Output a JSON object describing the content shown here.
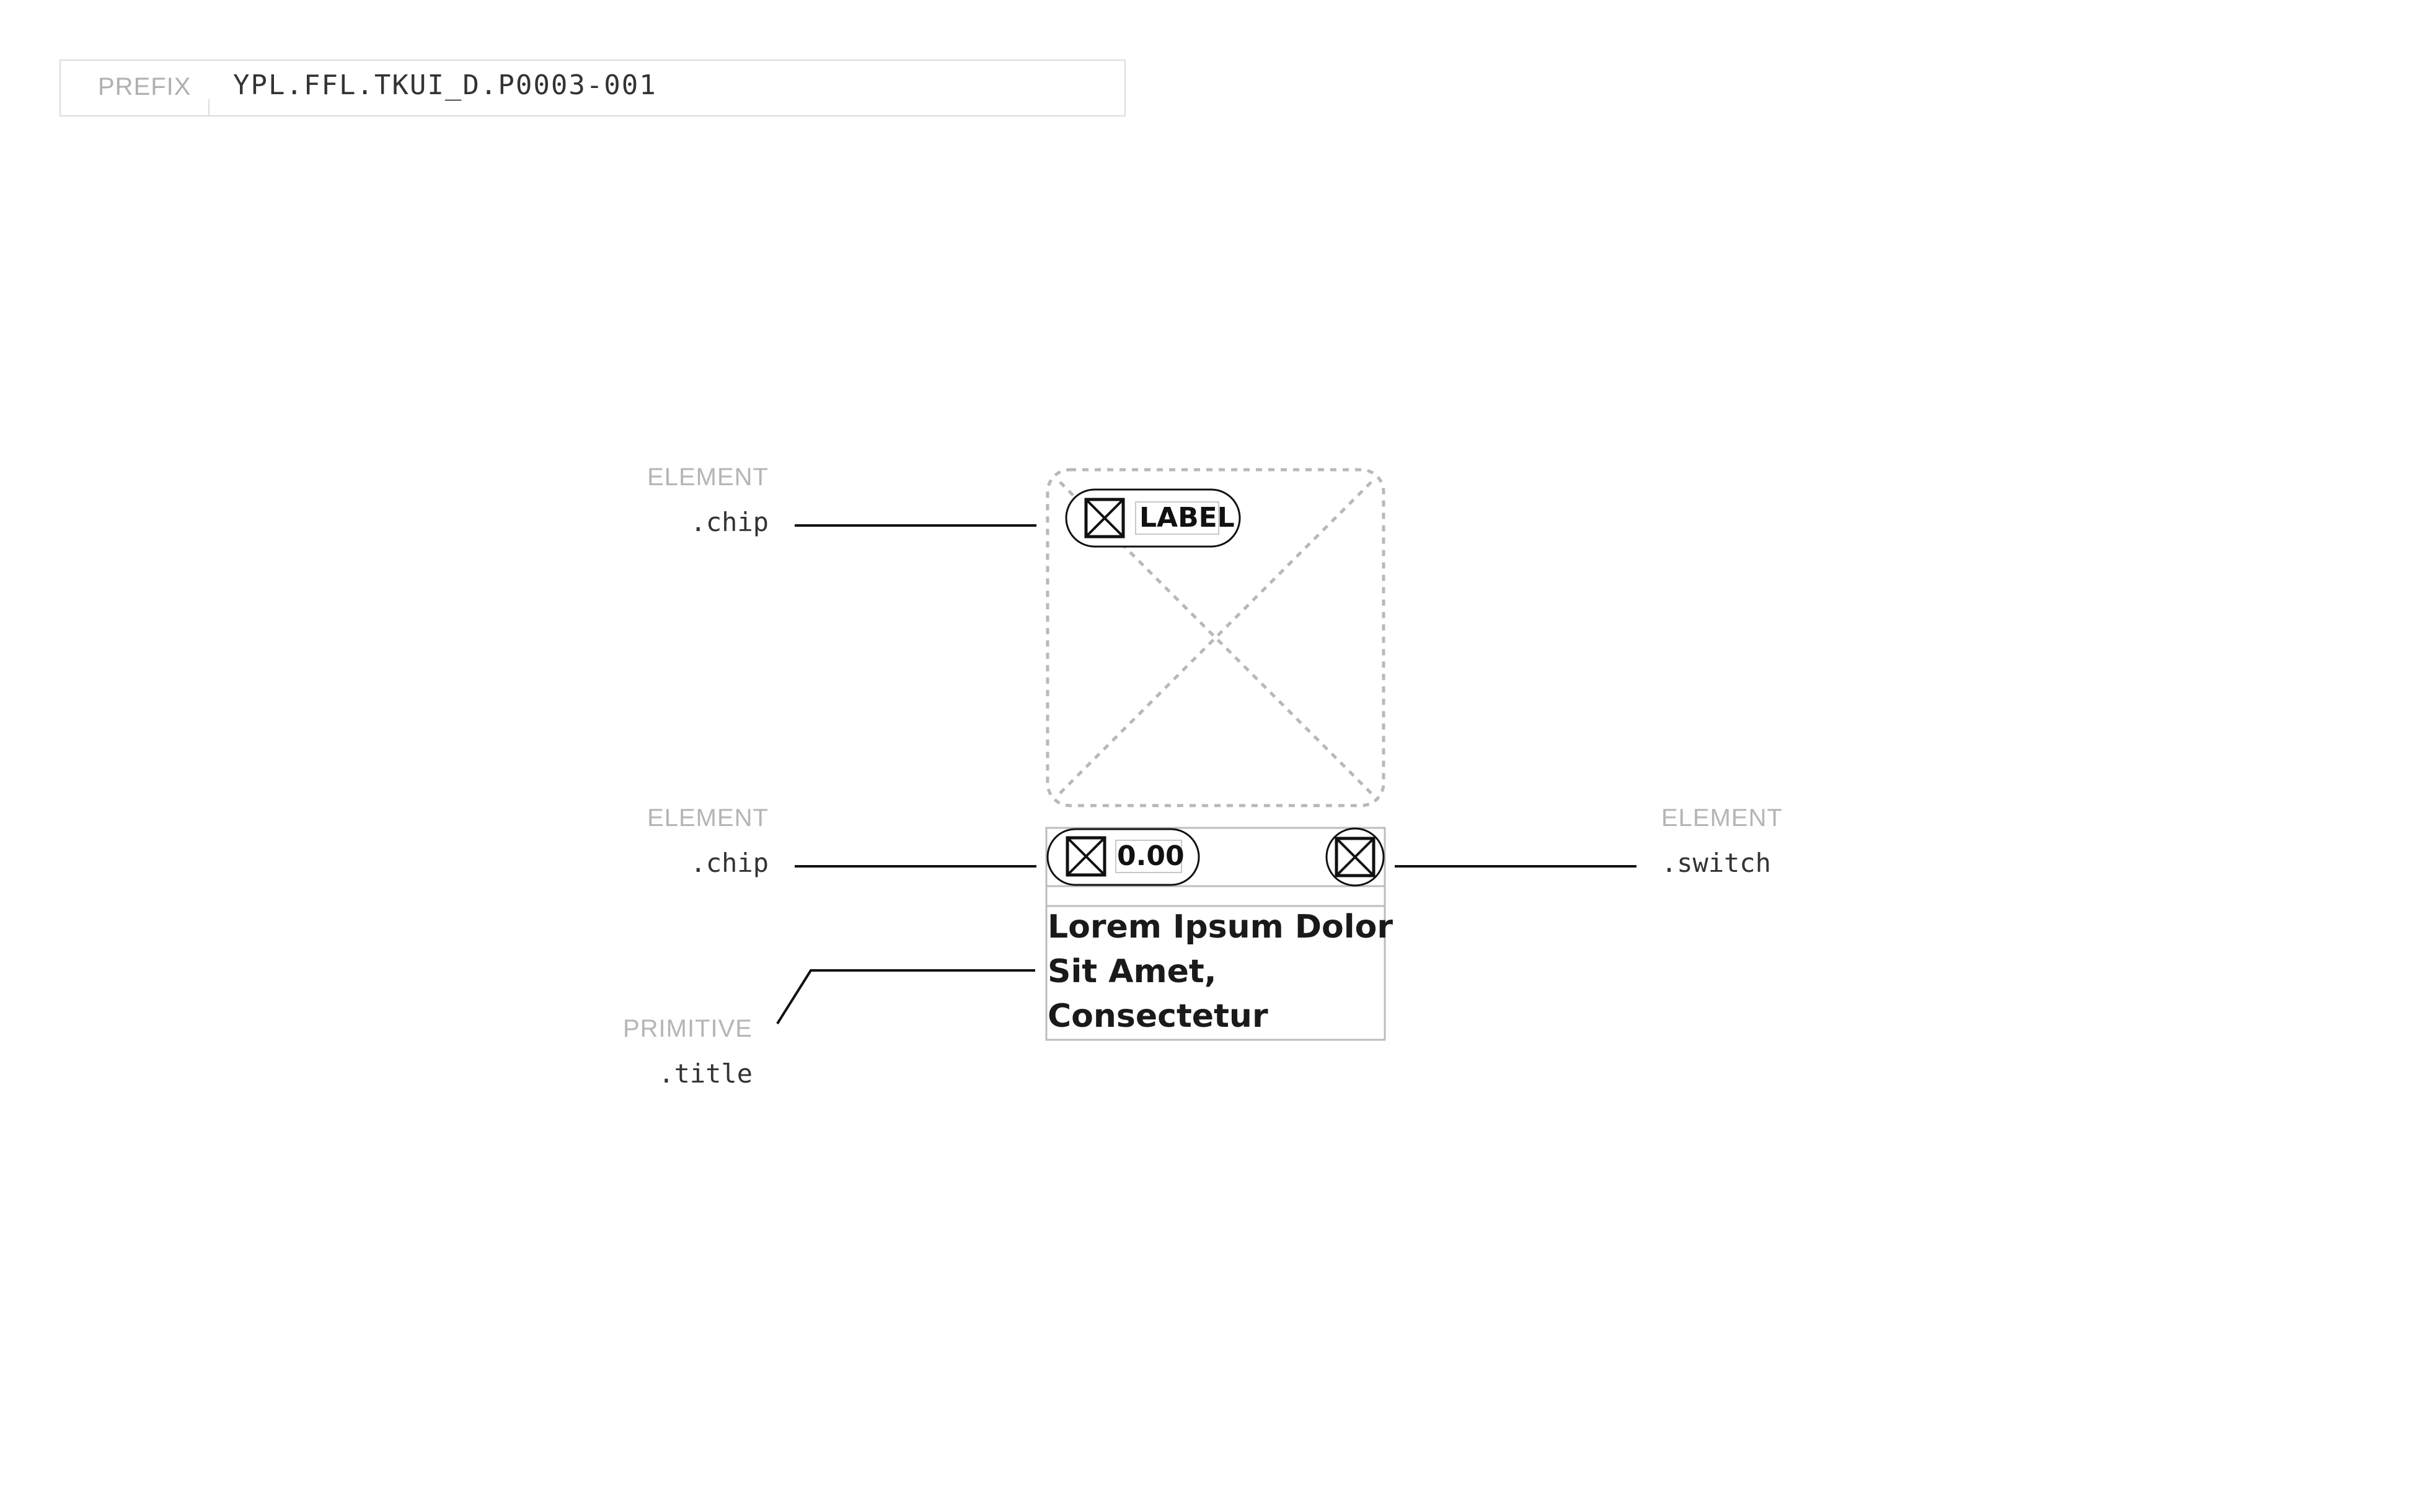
{
  "header": {
    "prefix_label": "PREFIX",
    "prefix_value": "YPL.FFL.TKUI_D.P0003-001"
  },
  "annotations": {
    "chip_top": {
      "type": "ELEMENT",
      "class_name": ".chip"
    },
    "chip_bottom": {
      "type": "ELEMENT",
      "class_name": ".chip"
    },
    "switch": {
      "type": "ELEMENT",
      "class_name": ".switch"
    },
    "title": {
      "type": "PRIMITIVE",
      "class_name": ".title"
    }
  },
  "component": {
    "chip_top_label": "LABEL",
    "chip_value": "0.00",
    "title_line_1": "Lorem Ipsum Dolor",
    "title_line_2": "Sit Amet,",
    "title_line_3": "Consectetur"
  },
  "icons": {
    "chip_top_icon": "placeholder-x-icon",
    "chip_bottom_icon": "placeholder-x-icon",
    "switch_icon": "placeholder-x-icon",
    "image": "image-placeholder"
  },
  "colors": {
    "line": "#111111",
    "muted_text": "#b0b0b0",
    "border": "#bdbdbd",
    "dashed": "#b8b8b8"
  }
}
